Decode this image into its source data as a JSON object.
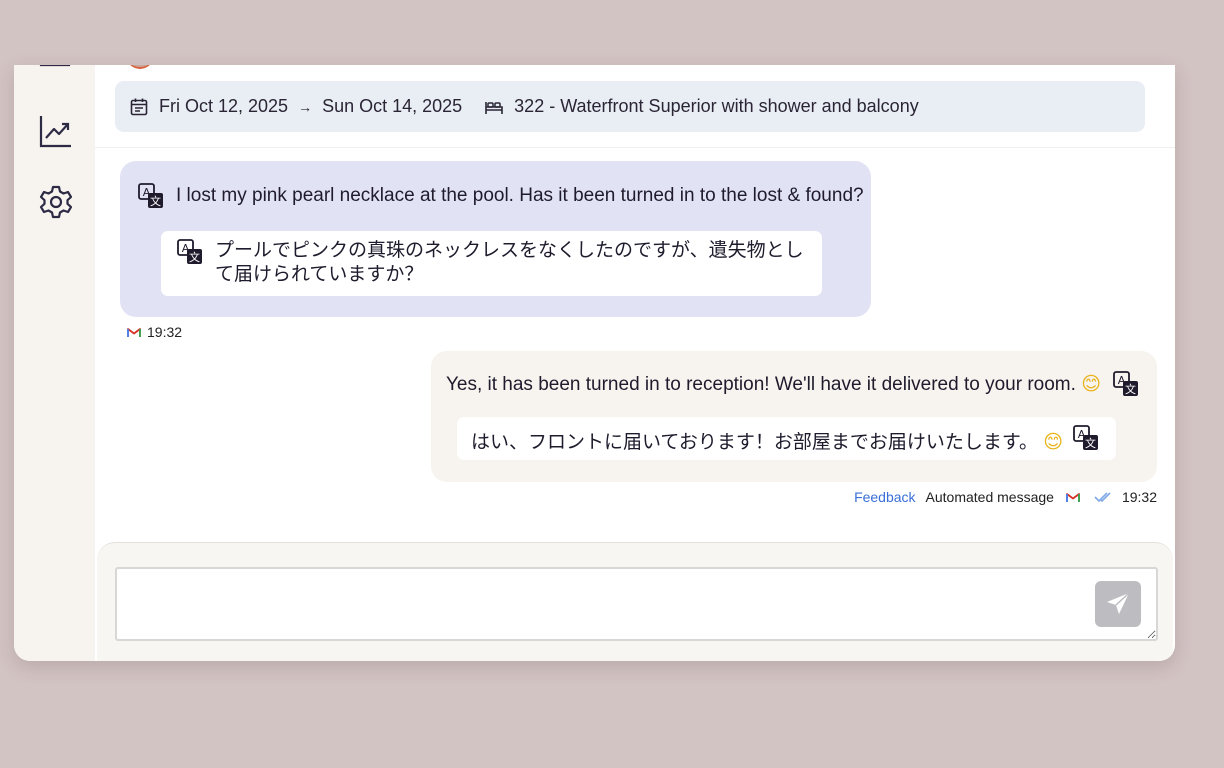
{
  "colors": {
    "background": "#d2c4c3",
    "sidebar": "#f7f3ee",
    "incoming_bubble": "#e1e3f4",
    "outgoing_bubble": "#f7f3ee",
    "stay_bar": "#e9edf4",
    "feedback_link": "#3a6fd8",
    "send_button": "#bdbcc0"
  },
  "sidebar": {
    "items": [
      {
        "icon": "chart-icon"
      },
      {
        "icon": "gear-icon"
      }
    ]
  },
  "stay": {
    "calendar_icon": "calendar-icon",
    "check_in": "Fri Oct 12, 2025",
    "arrow": "→",
    "check_out": "Sun Oct 14, 2025",
    "room_icon": "bed-icon",
    "room": "322 - Waterfront Superior with shower and balcony"
  },
  "messages": [
    {
      "direction": "incoming",
      "original": "I lost my pink pearl necklace at the pool. Has it been turned in to the lost & found?",
      "translation": "プールでピンクの真珠のネックレスをなくしたのですが、遺失物として届けられていますか？",
      "channel_icon": "gmail-icon",
      "time": "19:32"
    },
    {
      "direction": "outgoing",
      "original": "Yes, it has been turned in to reception! We'll have it delivered to your room.",
      "translation": "はい、フロントに届いております！お部屋までお届けいたします。",
      "emoji": "😊",
      "feedback_label": "Feedback",
      "status_label": "Automated message",
      "channel_icon": "gmail-icon",
      "read_icon": "double-check-icon",
      "time": "19:32"
    }
  ],
  "composer": {
    "value": "",
    "send_icon": "paper-plane-icon"
  }
}
